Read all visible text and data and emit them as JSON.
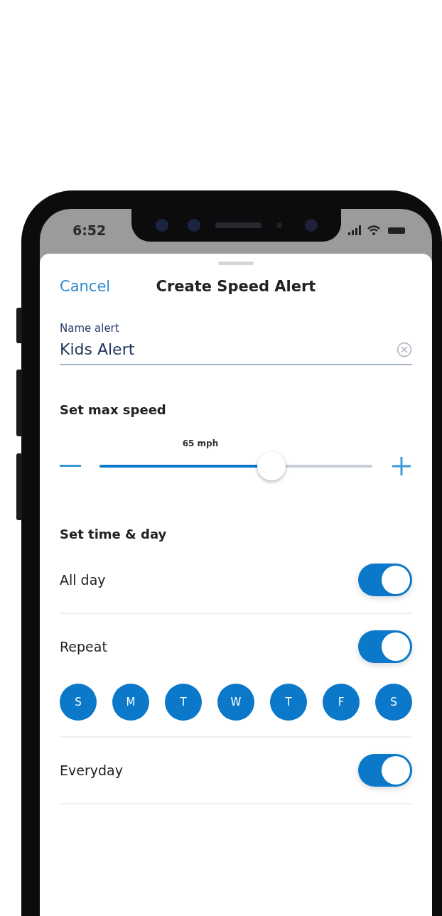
{
  "status_bar": {
    "time": "6:52"
  },
  "header": {
    "cancel": "Cancel",
    "title": "Create Speed Alert"
  },
  "name_field": {
    "label": "Name alert",
    "value": "Kids Alert"
  },
  "max_speed": {
    "heading": "Set max speed",
    "reading": "65 mph",
    "level": 0.63
  },
  "time_day": {
    "heading": "Set time & day",
    "rows": [
      {
        "kind": "toggle",
        "label": "All day",
        "on": true
      },
      {
        "kind": "toggle",
        "label": "Repeat",
        "on": true
      },
      {
        "kind": "days",
        "days": [
          {
            "label": "S",
            "selected": true
          },
          {
            "label": "M",
            "selected": true
          },
          {
            "label": "T",
            "selected": true
          },
          {
            "label": "W",
            "selected": true
          },
          {
            "label": "T",
            "selected": true
          },
          {
            "label": "F",
            "selected": true
          },
          {
            "label": "S",
            "selected": true
          }
        ]
      },
      {
        "kind": "toggle",
        "label": "Everyday",
        "on": true
      }
    ]
  }
}
